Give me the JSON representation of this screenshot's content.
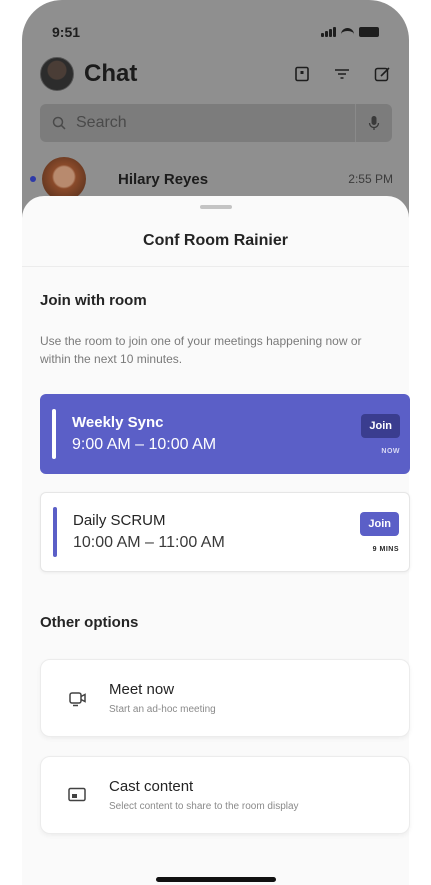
{
  "status_bar": {
    "time": "9:51"
  },
  "chat_header": {
    "title": "Chat"
  },
  "search": {
    "placeholder": "Search"
  },
  "chat_list": [
    {
      "name": "Hilary Reyes",
      "time": "2:55 PM",
      "unread": true
    }
  ],
  "sheet": {
    "title": "Conf Room Rainier",
    "join_section": {
      "title": "Join with room",
      "description": "Use the room to join one of your meetings happening now or within the next 10 minutes.",
      "meetings": [
        {
          "name": "Weekly Sync",
          "time": "9:00 AM – 10:00 AM",
          "join_label": "Join",
          "badge": "NOW",
          "active": true
        },
        {
          "name": "Daily SCRUM",
          "time": "10:00 AM – 11:00 AM",
          "join_label": "Join",
          "badge": "9 MINS",
          "active": false
        }
      ]
    },
    "other_section": {
      "title": "Other options",
      "options": [
        {
          "title": "Meet now",
          "subtitle": "Start an ad-hoc meeting",
          "icon": "camera-icon"
        },
        {
          "title": "Cast content",
          "subtitle": "Select content to share to the room display",
          "icon": "cast-icon"
        }
      ]
    }
  },
  "colors": {
    "accent": "#5b5fc7",
    "accent_dark": "#3a3d8f",
    "overlay": "#8f8f8f",
    "sheet_bg": "#fafafa"
  }
}
